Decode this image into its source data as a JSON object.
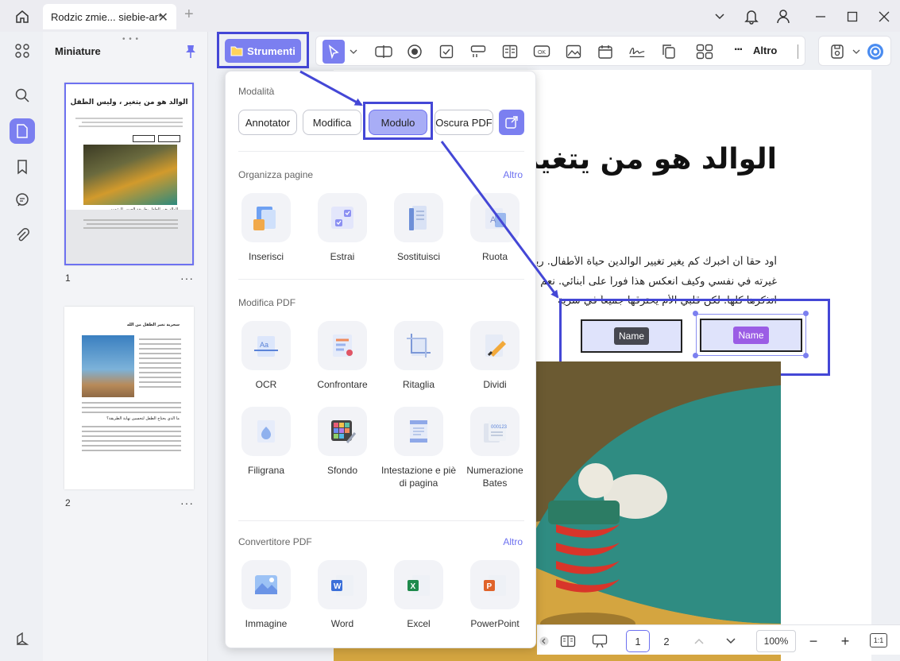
{
  "window": {
    "tab_title": "Rodzic zmie... siebie-ar*",
    "tab_close": "✕",
    "tab_add": "+"
  },
  "thumbnails": {
    "title": "Miniature",
    "pages": [
      {
        "number": "1",
        "more": "···",
        "heading": "الوالد هو من يتغير ، وليس الطفل",
        "subheading": "الوالد يغير الطفل بطريقة الحبس الرئيسي"
      },
      {
        "number": "2",
        "more": "···",
        "heading": "سحرية تغير الطفل من الله",
        "subheading": "ما الذي يحتاج الطفل لتحسين نهاية الطريقة؟"
      }
    ]
  },
  "toolbar": {
    "strumenti_label": "Strumenti",
    "altro_label": "Altro",
    "more_dots": "···"
  },
  "panel": {
    "modalita_title": "Modalità",
    "modes": [
      {
        "label": "Annotator"
      },
      {
        "label": "Modifica"
      },
      {
        "label": "Modulo"
      },
      {
        "label": "Oscura PDF"
      }
    ],
    "organizza": {
      "title": "Organizza pagine",
      "more": "Altro",
      "items": [
        "Inserisci",
        "Estrai",
        "Sostituisci",
        "Ruota"
      ]
    },
    "modifica_pdf": {
      "title": "Modifica PDF",
      "row1": [
        "OCR",
        "Confrontare",
        "Ritaglia",
        "Dividi"
      ],
      "row2": [
        "Filigrana",
        "Sfondo",
        "Intestazione e piè di pagina",
        "Numerazione Bates"
      ]
    },
    "convertitore": {
      "title": "Convertitore PDF",
      "more": "Altro",
      "items": [
        "Immagine",
        "Word",
        "Excel",
        "PowerPoint"
      ]
    }
  },
  "document": {
    "heading": "الوالد هو من يتغير،",
    "lines": [
      "أود حقاً أن أخبرك كم يغير تغيير الوالدين حياة الأطفال. ربما",
      "غيرته في نفسي وكيف انعكس هذا فوراً على أبنائي. نعم",
      "اتذكرها كلها. لكن قلبي الأم يحترقها جميعاً في سرية"
    ],
    "field1_label": "Name",
    "field2_label": "Name"
  },
  "bottombar": {
    "page1": "1",
    "page2": "2",
    "zoom": "100%",
    "minus": "−",
    "plus": "+",
    "fit": "1:1"
  },
  "colors": {
    "accent": "#7b7ff0",
    "highlight": "#4447d6"
  }
}
